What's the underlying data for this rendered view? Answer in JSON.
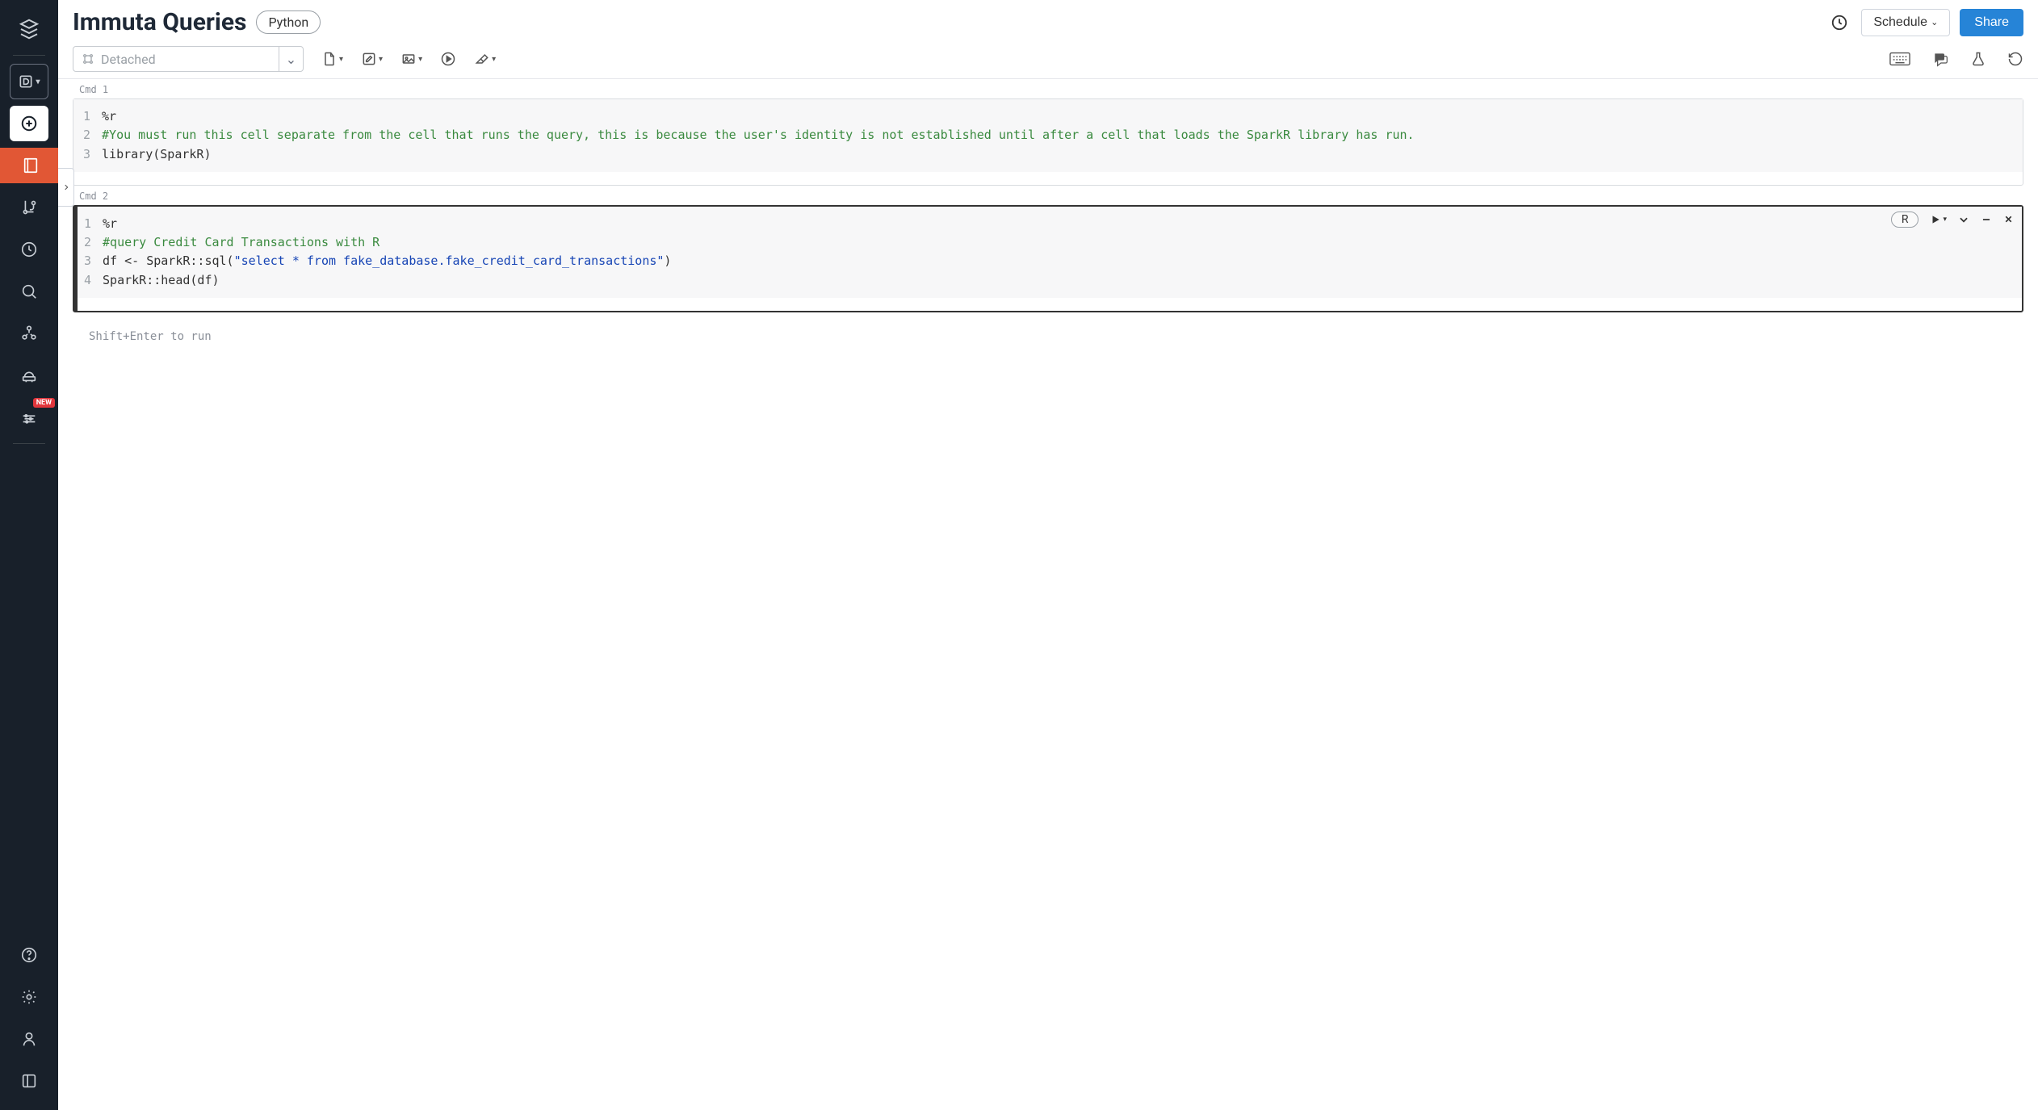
{
  "header": {
    "title": "Immuta Queries",
    "language_pill": "Python",
    "schedule_label": "Schedule",
    "share_label": "Share"
  },
  "toolbar": {
    "cluster_state": "Detached"
  },
  "sidebar": {
    "new_badge": "NEW"
  },
  "cells": [
    {
      "label": "Cmd 1",
      "gutter": [
        "1",
        "2",
        "",
        "3"
      ],
      "lines": [
        {
          "t": "%r",
          "cls": "mag"
        },
        {
          "t": "#You must run this cell separate from the cell that runs the query, this is because the user's identity is not established until after a cell that loads the SparkR library has run.",
          "cls": "cmt"
        },
        {
          "t": "library(SparkR)",
          "cls": "fn"
        }
      ]
    },
    {
      "label": "Cmd 2",
      "lang_badge": "R",
      "gutter": [
        "1",
        "2",
        "3",
        "4"
      ],
      "lines_raw": {
        "l1": "%r",
        "l2": "#query Credit Card Transactions with R",
        "l3_pre": "df <- SparkR::sql(",
        "l3_str": "\"select * from fake_database.fake_credit_card_transactions\"",
        "l3_post": ")",
        "l4": "SparkR::head(df)"
      }
    }
  ],
  "run_hint": "Shift+Enter to run"
}
